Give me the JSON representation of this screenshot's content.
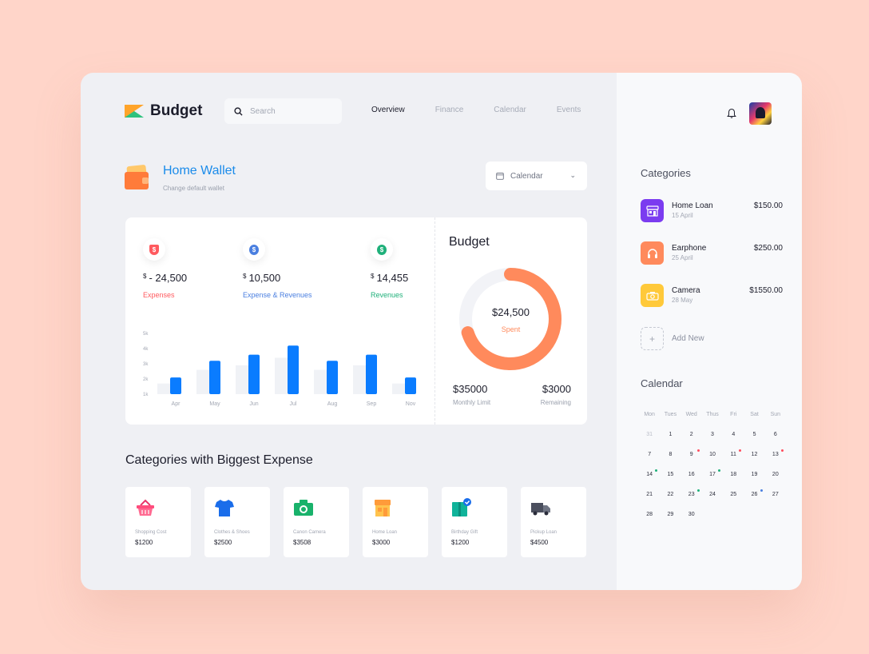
{
  "app": {
    "name": "Budget"
  },
  "search": {
    "placeholder": "Search"
  },
  "nav": [
    {
      "label": "Overview",
      "active": true
    },
    {
      "label": "Finance",
      "active": false
    },
    {
      "label": "Calendar",
      "active": false
    },
    {
      "label": "Events",
      "active": false
    }
  ],
  "wallet": {
    "title": "Home Wallet",
    "subtitle": "Change default wallet",
    "selector": "Calendar"
  },
  "stats": [
    {
      "currency": "$",
      "value": "- 24,500",
      "label": "Expenses",
      "color": "#ff5a5f",
      "icon": "shield-dollar-icon"
    },
    {
      "currency": "$",
      "value": "10,500",
      "label": "Expense & Revenues",
      "color": "#4a7fe0",
      "icon": "pin-dollar-icon"
    },
    {
      "currency": "$",
      "value": "14,455",
      "label": "Revenues",
      "color": "#1fb07a",
      "icon": "coin-dollar-icon"
    }
  ],
  "chart_data": {
    "type": "bar",
    "categories": [
      "Apr",
      "May",
      "Jun",
      "Jul",
      "Aug",
      "Sep",
      "Nov"
    ],
    "series": [
      {
        "color": "#0a7cff",
        "values": [
          2.1,
          3.2,
          3.6,
          4.2,
          3.2,
          3.6,
          2.1
        ]
      },
      {
        "color": "#f0f2f6",
        "values": [
          1.7,
          2.6,
          2.9,
          3.4,
          2.6,
          2.9,
          1.7
        ]
      }
    ],
    "yticks": [
      "1k",
      "2k",
      "3k",
      "4k",
      "5k"
    ],
    "ylim": [
      1,
      5
    ],
    "grid": false
  },
  "budget": {
    "title": "Budget",
    "spent_value": "$24,500",
    "spent_label": "Spent",
    "spent_fraction": 0.7,
    "limit_value": "$35000",
    "limit_label": "Monthly Limit",
    "remaining_value": "$3000",
    "remaining_label": "Remaining",
    "accent": "#ff8a5c"
  },
  "biggest": {
    "title": "Categories with Biggest Expense",
    "tiles": [
      {
        "name": "Shopping Cost",
        "amount": "$1200",
        "icon": "basket-icon"
      },
      {
        "name": "Clothes & Shoes",
        "amount": "$2500",
        "icon": "tshirt-icon"
      },
      {
        "name": "Canon Camera",
        "amount": "$3508",
        "icon": "camera-icon"
      },
      {
        "name": "Home Loan",
        "amount": "$3000",
        "icon": "store-icon"
      },
      {
        "name": "Birthday Gift",
        "amount": "$1200",
        "icon": "gift-icon"
      },
      {
        "name": "Pickup Loan",
        "amount": "$4500",
        "icon": "truck-icon"
      }
    ]
  },
  "sidebar": {
    "categories_title": "Categories",
    "categories": [
      {
        "name": "Home Loan",
        "date": "15 April",
        "amount": "$150.00",
        "color": "#7b3cf0",
        "icon": "store-icon"
      },
      {
        "name": "Earphone",
        "date": "25 April",
        "amount": "$250.00",
        "color": "#ff8a5c",
        "icon": "headphones-icon"
      },
      {
        "name": "Camera",
        "date": "28 May",
        "amount": "$1550.00",
        "color": "#ffc93a",
        "icon": "camera-icon"
      }
    ],
    "add_new": "Add New",
    "calendar_title": "Calendar",
    "weekdays": [
      "Mon",
      "Tues",
      "Wed",
      "Thus",
      "Fri",
      "Sat",
      "Sun"
    ],
    "weeks": [
      [
        "31",
        "1",
        "2",
        "3",
        "4",
        "5",
        "6"
      ],
      [
        "7",
        "8",
        "9",
        "10",
        "11",
        "12",
        "13"
      ],
      [
        "14",
        "15",
        "16",
        "17",
        "18",
        "19",
        "20"
      ],
      [
        "21",
        "22",
        "23",
        "24",
        "25",
        "26",
        "27"
      ],
      [
        "28",
        "29",
        "30",
        "",
        "",
        "",
        ""
      ]
    ],
    "marks": {
      "9": "#ff4d5e",
      "11": "#ff4d5e",
      "13": "#ff4d5e",
      "14": "#1fb07a",
      "17": "#1fb07a",
      "23": "#1fb07a",
      "26": "#4a7fe0"
    }
  }
}
